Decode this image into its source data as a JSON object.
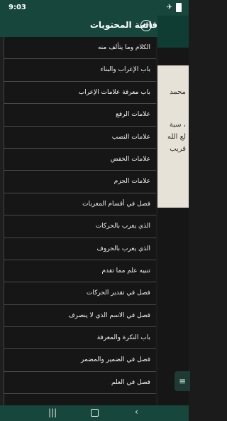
{
  "status_bar": {
    "time": "9:03"
  },
  "drawer": {
    "title": "قائمة المحتويات",
    "items": [
      "الكلام وما يتألف منه",
      "باب الإعراب والبناء",
      "باب معرفة علامات الإعراب",
      "علامات الرفع",
      "علامات النصب",
      "علامات الخفض",
      "علامات الجزم",
      "فصل في أقسام المعربات",
      "الذي يعرب بالحركات",
      "الذي يعرب بالحروف",
      "تنبيه علم مما تقدم",
      "فصل في تقدير الحركات",
      "فصل في الاسم الذي لا ينصرف",
      "باب النكرة والمعرفة",
      "فصل في الضمير والمضمر",
      "فصل في العلم"
    ]
  },
  "background_text": {
    "line1": "محمد",
    "line2": "سبة ،",
    "line3": "لع الله",
    "line4": "قريب"
  }
}
